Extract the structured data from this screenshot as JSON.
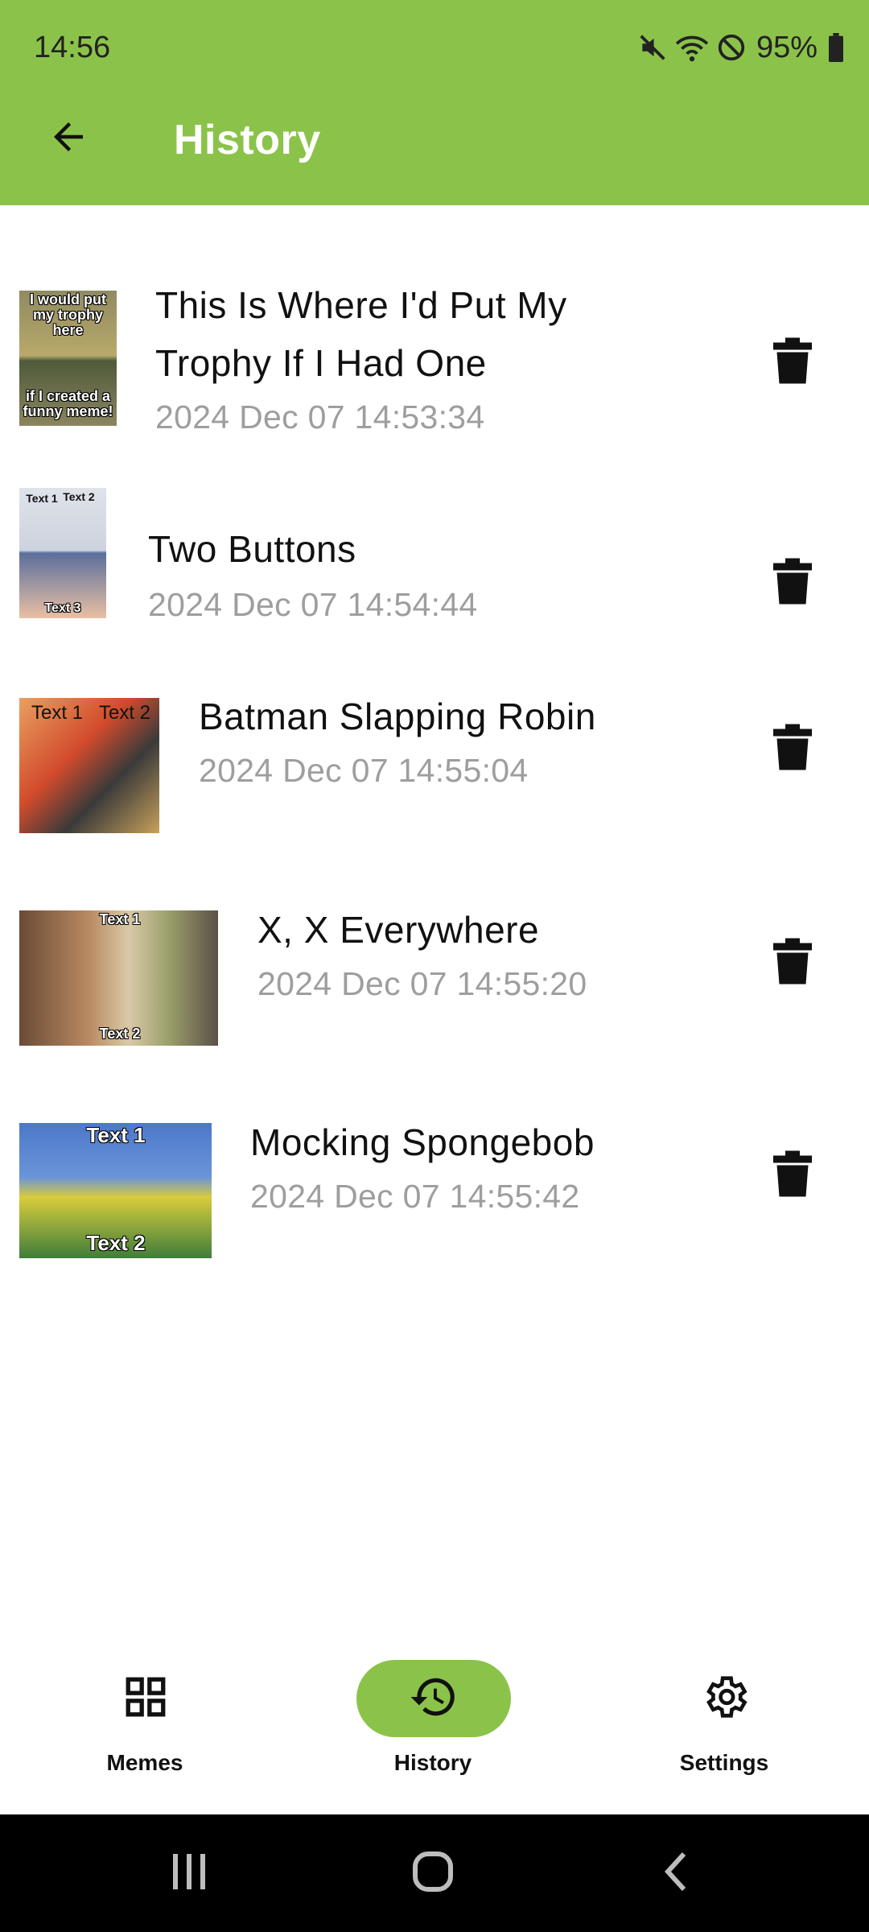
{
  "status_bar": {
    "time": "14:56",
    "battery": "95%",
    "icons": [
      "mute-icon",
      "wifi-icon",
      "do-not-disturb-icon",
      "battery-icon"
    ]
  },
  "app_bar": {
    "title": "History",
    "back_icon": "arrow-back-icon",
    "color": "#8BC34A"
  },
  "history": [
    {
      "title_line1": "This Is Where I'd Put My",
      "title_line2": "Trophy If I Had One",
      "timestamp": "2024 Dec 07 14:53:34",
      "thumb_captions": [
        "I would put my trophy here",
        "if I created a funny meme!"
      ]
    },
    {
      "title": "Two Buttons",
      "timestamp": "2024 Dec 07 14:54:44",
      "thumb_captions": [
        "Text 1",
        "Text 2",
        "Text 3"
      ]
    },
    {
      "title": "Batman Slapping Robin",
      "timestamp": "2024 Dec 07 14:55:04",
      "thumb_captions": [
        "Text 1",
        "Text 2"
      ]
    },
    {
      "title": "X, X Everywhere",
      "timestamp": "2024 Dec 07 14:55:20",
      "thumb_captions": [
        "Text 1",
        "Text 2"
      ]
    },
    {
      "title": "Mocking Spongebob",
      "timestamp": "2024 Dec 07 14:55:42",
      "thumb_captions": [
        "Text 1",
        "Text 2"
      ]
    }
  ],
  "bottom_nav": {
    "items": [
      {
        "label": "Memes",
        "icon": "grid-icon",
        "active": false
      },
      {
        "label": "History",
        "icon": "history-icon",
        "active": true
      },
      {
        "label": "Settings",
        "icon": "gear-icon",
        "active": false
      }
    ]
  },
  "system_nav": {
    "icons": [
      "recents-icon",
      "home-icon",
      "back-icon"
    ]
  }
}
